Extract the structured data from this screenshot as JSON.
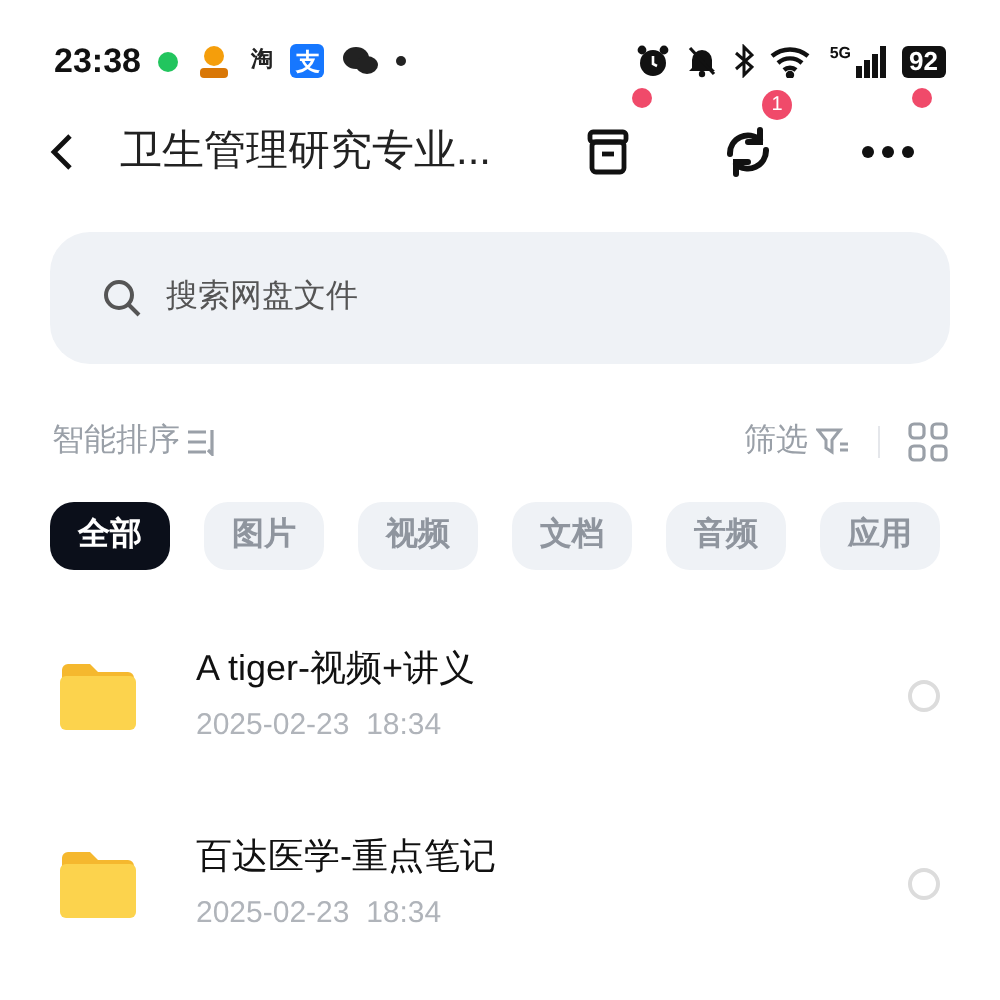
{
  "status_bar": {
    "time": "23:38",
    "taobao_label": "淘",
    "alipay_label": "支",
    "network": "5G",
    "battery": "92"
  },
  "header": {
    "title": "卫生管理研究专业...",
    "actions": [
      {
        "kind": "archive",
        "dot": true
      },
      {
        "kind": "sync",
        "badge": "1",
        "dot": false
      },
      {
        "kind": "more",
        "dot": true
      }
    ]
  },
  "search": {
    "placeholder": "搜索网盘文件"
  },
  "toolbar": {
    "sort": "智能排序",
    "filter": "筛选"
  },
  "chips": [
    {
      "label": "全部",
      "selected": true
    },
    {
      "label": "图片",
      "selected": false
    },
    {
      "label": "视频",
      "selected": false
    },
    {
      "label": "文档",
      "selected": false
    },
    {
      "label": "音频",
      "selected": false
    },
    {
      "label": "应用",
      "selected": false
    }
  ],
  "files": [
    {
      "name": "A tiger-视频+讲义",
      "date": "2025-02-23  18:34",
      "selected": false
    },
    {
      "name": "百达医学-重点笔记",
      "date": "2025-02-23  18:34",
      "selected": false
    }
  ]
}
